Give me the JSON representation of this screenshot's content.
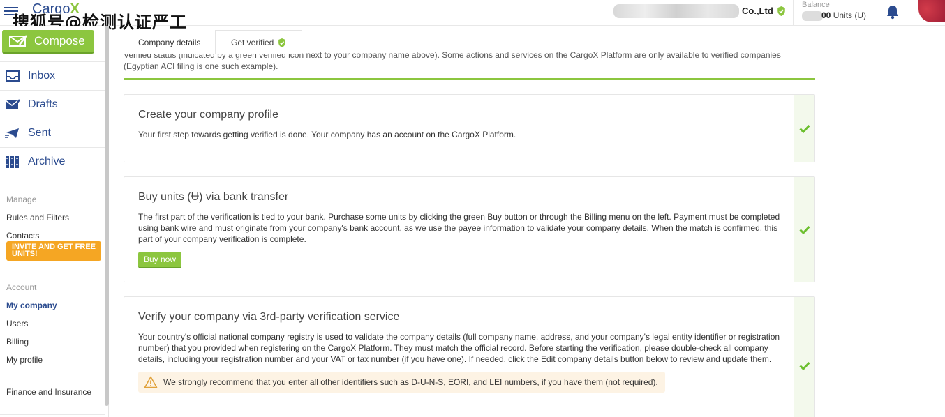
{
  "header": {
    "logo_text": "Cargo",
    "logo_x": "X",
    "watermark": "搜狐号@检测认证严工",
    "company_suffix": "Co.,Ltd",
    "balance_label": "Balance",
    "balance_value": "00",
    "balance_units": " Units (",
    "balance_symbol": "Ʉ",
    "balance_close": ")"
  },
  "sidebar": {
    "compose_label": "Compose",
    "nav": [
      {
        "label": "Inbox"
      },
      {
        "label": "Drafts"
      },
      {
        "label": "Sent"
      },
      {
        "label": "Archive"
      }
    ],
    "manage_label": "Manage",
    "rules_label": "Rules and Filters",
    "contacts_label": "Contacts",
    "invite_label": "INVITE AND GET FREE UNITS!",
    "account_label": "Account",
    "my_company_label": "My company",
    "users_label": "Users",
    "billing_label": "Billing",
    "my_profile_label": "My profile",
    "finance_label": "Finance and Insurance"
  },
  "tabs": [
    {
      "label": "Company details"
    },
    {
      "label": "Get verified"
    }
  ],
  "intro": {
    "line1": "Verified status (indicated by a green verified icon  next to your company name above). Some actions and services on the CargoX Platform are only available to verified companies",
    "line2": "(Egyptian ACI filing is one such example)."
  },
  "cards": [
    {
      "title": "Create your company profile",
      "desc": "Your first step towards getting verified is done. Your company has an account on the CargoX Platform."
    },
    {
      "title": "Buy units (Ʉ) via bank transfer",
      "desc": "The first part of the verification is tied to your bank. Purchase some units by clicking the green Buy button or through the Billing menu on the left. Payment must be completed using bank wire and must originate from your company's bank account, as we use the payee information to validate your company details. When the match is confirmed, this part of your company verification is complete.",
      "button": "Buy now"
    },
    {
      "title": "Verify your company via 3rd-party verification service",
      "desc": "Your country's official national company registry is used to validate the company details (full company name, address, and your company's legal entity identifier or registration number) that you provided when registering on the CargoX Platform. They must match the official record. Before starting the verification, please double-check all company details, including your registration number and your VAT or tax number (if you have one). If needed, click the Edit company details button below to review and update them.",
      "warning": "We strongly recommend that you enter all other identifiers such as D-U-N-S, EORI, and LEI numbers, if you have them (not required)."
    }
  ],
  "colors": {
    "brand_blue": "#2b4b8f",
    "accent_green": "#8cc63f",
    "invite_orange": "#f5a623"
  }
}
